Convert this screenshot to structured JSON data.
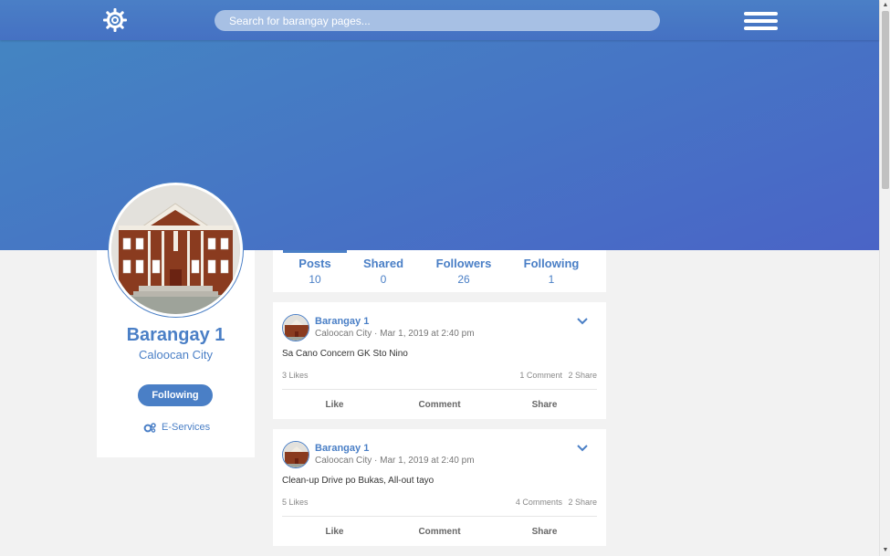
{
  "nav": {
    "search_placeholder": "Search for barangay pages..."
  },
  "profile": {
    "name": "Barangay 1",
    "city": "Caloocan City",
    "follow_label": "Following",
    "eservices_label": "E-Services"
  },
  "stats": [
    {
      "label": "Posts",
      "value": "10"
    },
    {
      "label": "Shared",
      "value": "0"
    },
    {
      "label": "Followers",
      "value": "26"
    },
    {
      "label": "Following",
      "value": "1"
    }
  ],
  "posts": [
    {
      "author": "Barangay 1",
      "meta": "Caloocan City · Mar 1, 2019 at 2:40 pm",
      "text": "Sa Cano Concern GK Sto Nino",
      "likes": "3 Likes",
      "comments": "1 Comment",
      "shares": "2 Share",
      "actions": {
        "like": "Like",
        "comment": "Comment",
        "share": "Share"
      }
    },
    {
      "author": "Barangay 1",
      "meta": "Caloocan City · Mar 1, 2019 at 2:40 pm",
      "text": "Clean-up Drive po Bukas, All-out tayo",
      "likes": "5 Likes",
      "comments": "4 Comments",
      "shares": "2 Share",
      "actions": {
        "like": "Like",
        "comment": "Comment",
        "share": "Share"
      }
    }
  ],
  "colors": {
    "accent": "#4a7fc6",
    "cover": "#4675c5",
    "page_bg": "#f2f2f2"
  },
  "icons": {
    "logo": "gear-seal-icon",
    "menu": "hamburger-icon",
    "eservices": "gears-icon",
    "post_menu": "chevron-down-icon"
  }
}
